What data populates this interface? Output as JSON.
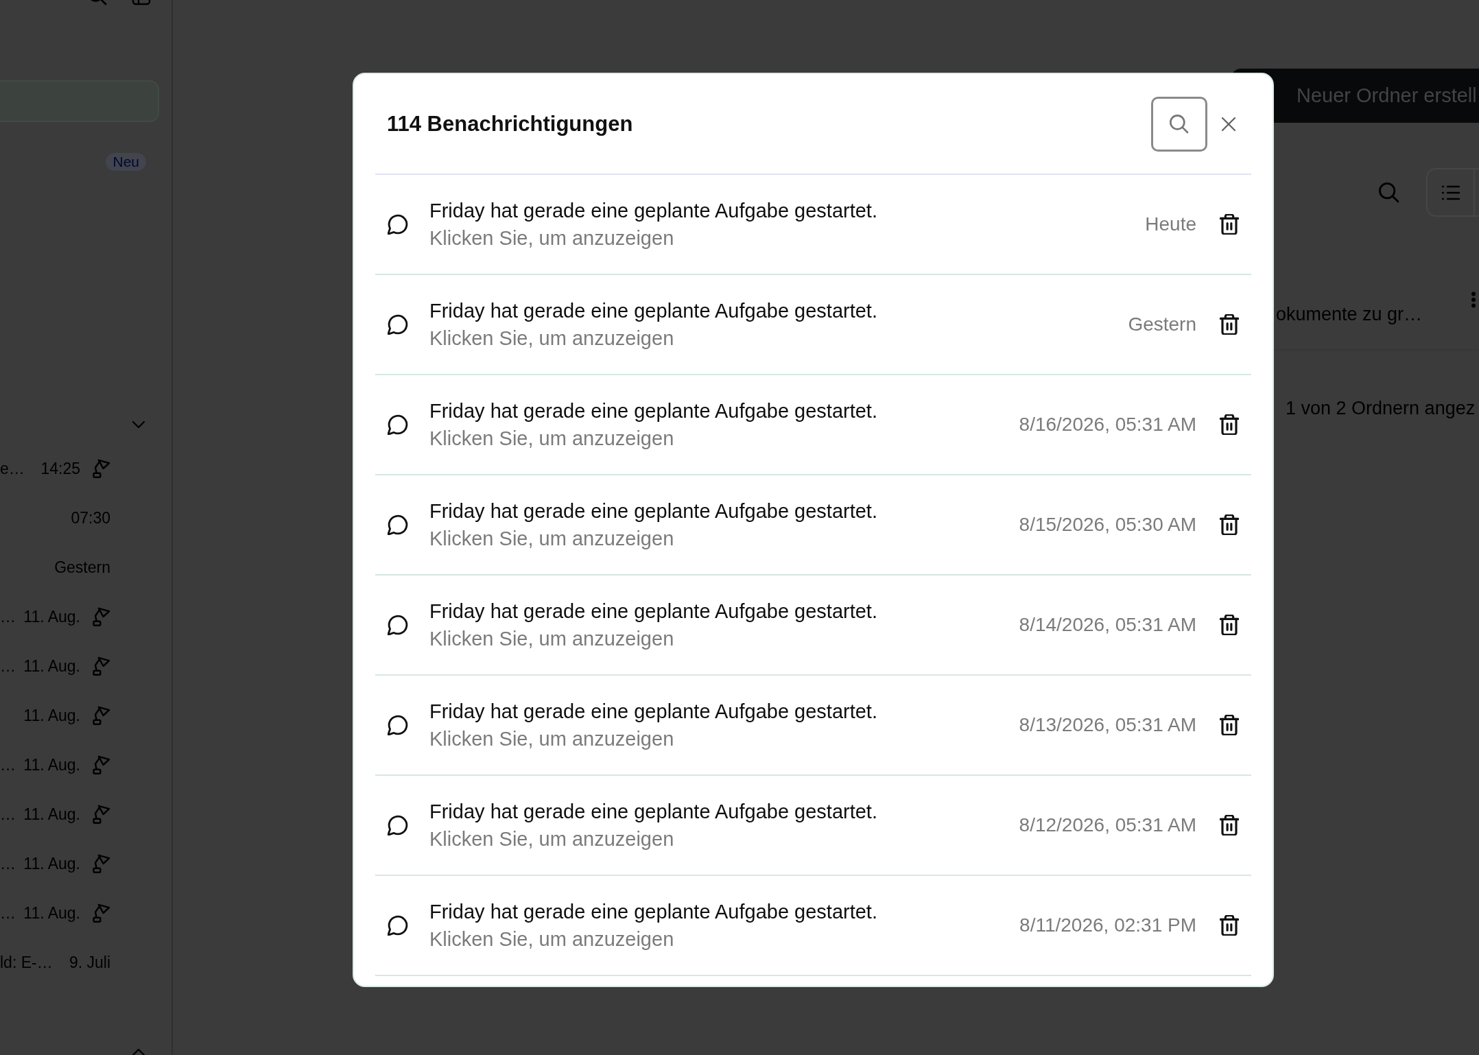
{
  "sidebar": {
    "badge": "Neu",
    "items": [
      {
        "title": "e…",
        "time": "14:25",
        "lamp": true
      },
      {
        "time": "07:30",
        "lamp": false
      },
      {
        "time": "Gestern",
        "lamp": false
      },
      {
        "title": "…",
        "time": "11. Aug.",
        "lamp": true
      },
      {
        "title": "…",
        "time": "11. Aug.",
        "lamp": true
      },
      {
        "time": "11. Aug.",
        "lamp": true
      },
      {
        "title": "…",
        "time": "11. Aug.",
        "lamp": true
      },
      {
        "title": "…",
        "time": "11. Aug.",
        "lamp": true
      },
      {
        "title": "…",
        "time": "11. Aug.",
        "lamp": true
      },
      {
        "title": "…",
        "time": "11. Aug.",
        "lamp": true
      },
      {
        "title": "ld: E-…",
        "time": "9. Juli",
        "lamp": false
      }
    ]
  },
  "main": {
    "new_folder_button": "Neuer Ordner erstell",
    "document_title": "okumente zu gr…",
    "folder_count": "1 von 2 Ordnern angez"
  },
  "dialog": {
    "title": "114 Benachrichtigungen",
    "notifications": [
      {
        "message": "Friday hat gerade eine geplante Aufgabe gestartet.",
        "hint": "Klicken Sie, um anzuzeigen",
        "time": "Heute"
      },
      {
        "message": "Friday hat gerade eine geplante Aufgabe gestartet.",
        "hint": "Klicken Sie, um anzuzeigen",
        "time": "Gestern"
      },
      {
        "message": "Friday hat gerade eine geplante Aufgabe gestartet.",
        "hint": "Klicken Sie, um anzuzeigen",
        "time": "8/16/2026, 05:31 AM"
      },
      {
        "message": "Friday hat gerade eine geplante Aufgabe gestartet.",
        "hint": "Klicken Sie, um anzuzeigen",
        "time": "8/15/2026, 05:30 AM"
      },
      {
        "message": "Friday hat gerade eine geplante Aufgabe gestartet.",
        "hint": "Klicken Sie, um anzuzeigen",
        "time": "8/14/2026, 05:31 AM"
      },
      {
        "message": "Friday hat gerade eine geplante Aufgabe gestartet.",
        "hint": "Klicken Sie, um anzuzeigen",
        "time": "8/13/2026, 05:31 AM"
      },
      {
        "message": "Friday hat gerade eine geplante Aufgabe gestartet.",
        "hint": "Klicken Sie, um anzuzeigen",
        "time": "8/12/2026, 05:31 AM"
      },
      {
        "message": "Friday hat gerade eine geplante Aufgabe gestartet.",
        "hint": "Klicken Sie, um anzuzeigen",
        "time": "8/11/2026, 02:31 PM"
      }
    ]
  }
}
